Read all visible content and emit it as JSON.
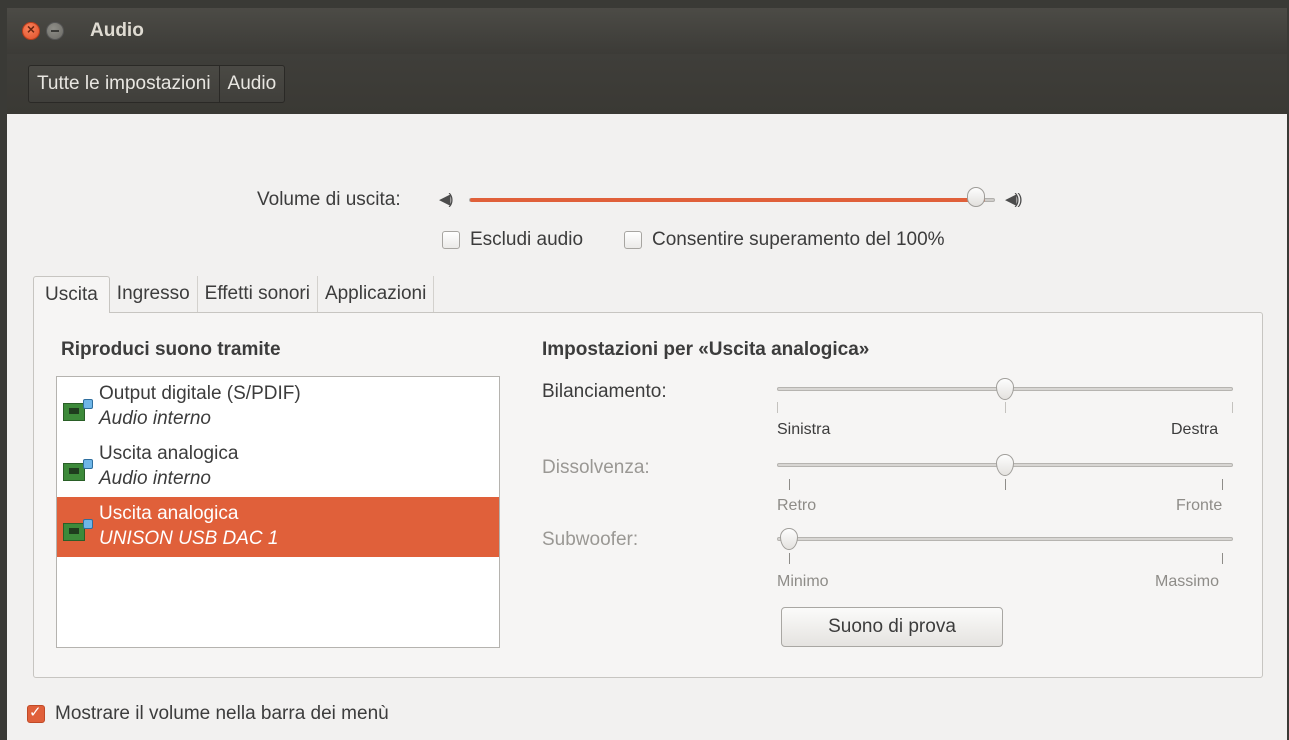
{
  "window": {
    "title": "Audio"
  },
  "breadcrumb": [
    "Tutte le impostazioni",
    "Audio"
  ],
  "volume": {
    "label": "Volume di uscita:",
    "level": 0.98,
    "mute_label": "Escludi audio",
    "mute_checked": false,
    "overamp_label": "Consentire superamento del 100%",
    "overamp_checked": false,
    "accent_color": "#e0603a"
  },
  "tabs": [
    "Uscita",
    "Ingresso",
    "Effetti sonori",
    "Applicazioni"
  ],
  "active_tab": "Uscita",
  "output": {
    "list_heading": "Riproduci suono tramite",
    "devices": [
      {
        "name": "Output digitale (S/PDIF)",
        "sub": "Audio interno",
        "selected": false,
        "icon": "sound-card-icon"
      },
      {
        "name": "Uscita analogica",
        "sub": "Audio interno",
        "selected": false,
        "icon": "sound-card-icon"
      },
      {
        "name": "Uscita analogica",
        "sub": "UNISON USB DAC 1",
        "selected": true,
        "icon": "sound-card-icon"
      }
    ],
    "settings_heading": "Impostazioni per «Uscita analogica»",
    "balance": {
      "label": "Bilanciamento:",
      "left": "Sinistra",
      "right": "Destra",
      "value": 0.5
    },
    "fade": {
      "label": "Dissolvenza:",
      "left": "Retro",
      "right": "Fronte",
      "value": 0.5,
      "disabled": true
    },
    "subwoofer": {
      "label": "Subwoofer:",
      "left": "Minimo",
      "right": "Massimo",
      "value": 0.0,
      "disabled": true
    },
    "test_button": "Suono di prova"
  },
  "footer": {
    "show_volume_label": "Mostrare il volume nella barra dei menù",
    "show_volume_checked": true
  }
}
